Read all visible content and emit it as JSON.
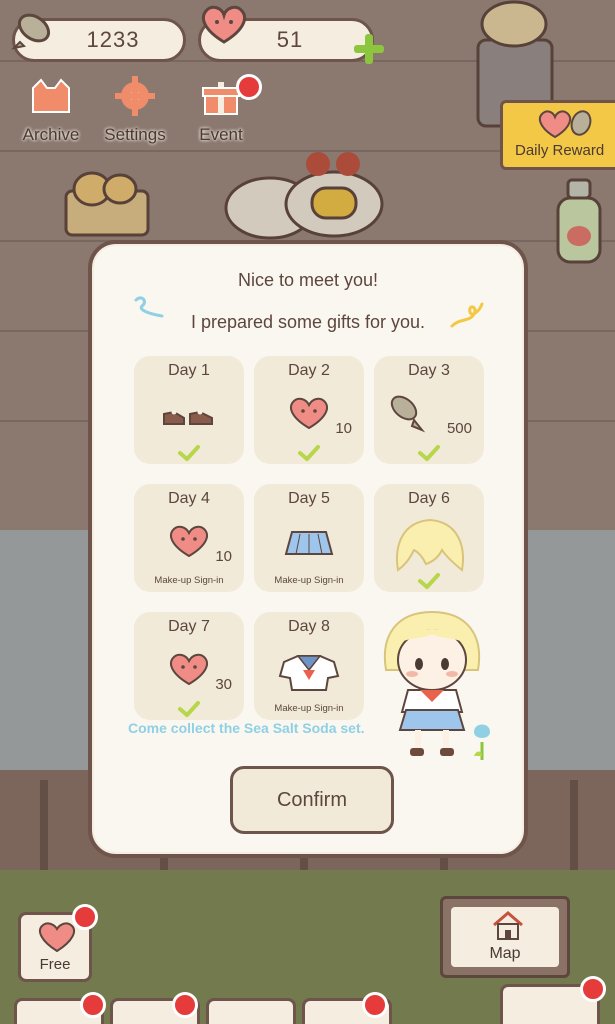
{
  "hud": {
    "fish_count": "1233",
    "heart_count": "51",
    "plus_icon": "plus-icon"
  },
  "menu": {
    "archive_label": "Archive",
    "settings_label": "Settings",
    "event_label": "Event",
    "daily_reward_label": "Daily Reward"
  },
  "dialog": {
    "title": "Nice to meet you!",
    "subtitle": "I prepared some gifts for you.",
    "days": [
      {
        "label": "Day 1",
        "reward": "shoes",
        "amount": "",
        "status": "claimed",
        "makeup": ""
      },
      {
        "label": "Day 2",
        "reward": "heart",
        "amount": "10",
        "status": "claimed",
        "makeup": ""
      },
      {
        "label": "Day 3",
        "reward": "fish",
        "amount": "500",
        "status": "claimed",
        "makeup": ""
      },
      {
        "label": "Day 4",
        "reward": "heart",
        "amount": "10",
        "status": "makeup",
        "makeup": "Make-up Sign-in"
      },
      {
        "label": "Day 5",
        "reward": "skirt",
        "amount": "",
        "status": "makeup",
        "makeup": "Make-up Sign-in"
      },
      {
        "label": "Day 6",
        "reward": "hair",
        "amount": "",
        "status": "claimed",
        "makeup": ""
      },
      {
        "label": "Day 7",
        "reward": "heart",
        "amount": "30",
        "status": "claimed",
        "makeup": ""
      },
      {
        "label": "Day 8",
        "reward": "sailor-top",
        "amount": "",
        "status": "makeup",
        "makeup": "Make-up Sign-in"
      }
    ],
    "promo_text": "Come collect the Sea Salt Soda set.",
    "confirm_label": "Confirm"
  },
  "bottom": {
    "free_label": "Free",
    "map_label": "Map"
  },
  "colors": {
    "border": "#6e544a",
    "check": "#b7d64a",
    "heart": "#f08c86",
    "promo": "#8fd0e4",
    "notify": "#e63b3b"
  }
}
